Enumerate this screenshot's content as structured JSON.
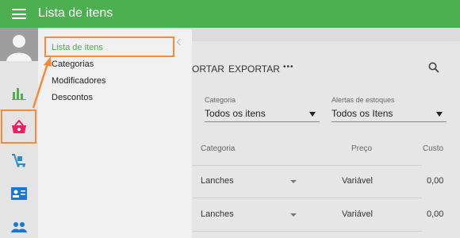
{
  "topbar": {
    "title": "Lista de itens"
  },
  "dropdown": {
    "items": [
      "Lista de itens",
      "Categorias",
      "Modificadores",
      "Descontos"
    ]
  },
  "toolbar": {
    "import_label": "ORTAR",
    "export_label": "EXPORTAR",
    "more_label": "•••"
  },
  "filters": {
    "category": {
      "label": "Categoria",
      "value": "Todos os itens"
    },
    "stock": {
      "label": "Alertas de estoques",
      "value": "Todos os Itens"
    }
  },
  "table": {
    "headers": {
      "category": "Categoria",
      "price": "Preço",
      "cost": "Custo"
    },
    "rows": [
      {
        "category": "Lanches",
        "price": "Variável",
        "cost": "0,00"
      },
      {
        "category": "Lanches",
        "price": "Variável",
        "cost": "0,00"
      }
    ]
  },
  "colors": {
    "brand": "#4caf50",
    "highlight": "#f28c38",
    "accent_pink": "#e91e63"
  }
}
